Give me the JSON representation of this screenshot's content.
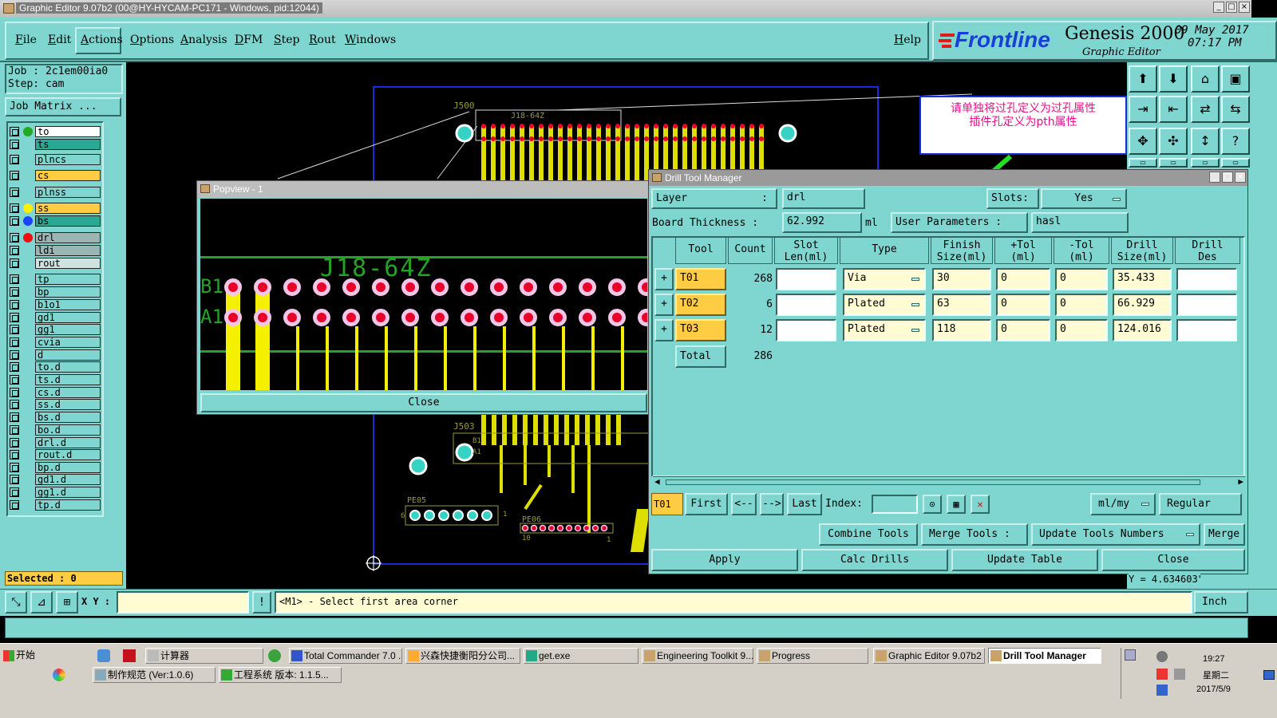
{
  "app": {
    "window_title": "Graphic Editor 9.07b2 (00@HY-HYCAM-PC171 - Windows, pid:12044)",
    "menus": [
      "File",
      "Edit",
      "Actions",
      "Options",
      "Analysis",
      "DFM",
      "Step",
      "Rout",
      "Windows"
    ],
    "help": "Help",
    "brand_logo": "Frontline",
    "product": "Genesis 2000",
    "product_sub": "Graphic Editor",
    "date": "09 May 2017",
    "time": "07:17 PM"
  },
  "left_panel": {
    "job_label": "Job : 2c1em00ia0",
    "step_label": "Step: cam",
    "job_matrix": "Job Matrix ...",
    "layers": [
      {
        "name": "to",
        "color": "#22aa22",
        "dot": "#22aa22",
        "bg": "#ffffff"
      },
      {
        "name": "ts",
        "color": "#2e8b7e",
        "dot": "",
        "bg": "#2aa896"
      },
      {
        "name": "plncs",
        "color": "",
        "dot": "",
        "bg": "#7fd5cf"
      },
      {
        "name": "cs",
        "color": "",
        "dot": "",
        "bg": "#ffcc44"
      },
      {
        "name": "plnss",
        "color": "",
        "dot": "",
        "bg": "#7fd5cf"
      },
      {
        "name": "ss",
        "color": "",
        "dot": "#ffee00",
        "bg": "#ffcc44"
      },
      {
        "name": "bs",
        "color": "",
        "dot": "#1a44ff",
        "bg": "#2aa896"
      },
      {
        "name": "drl",
        "color": "",
        "dot": "#ee1111",
        "bg": "#9bb5b3"
      },
      {
        "name": "ldi",
        "color": "",
        "dot": "",
        "bg": "#9bb5b3"
      },
      {
        "name": "rout",
        "color": "",
        "dot": "",
        "bg": "#cfe2e0"
      },
      {
        "name": "tp",
        "color": "",
        "dot": "",
        "bg": "#7fd5cf"
      },
      {
        "name": "bp",
        "color": "",
        "dot": "",
        "bg": "#7fd5cf"
      },
      {
        "name": "b1o1",
        "color": "",
        "dot": "",
        "bg": "#7fd5cf"
      },
      {
        "name": "gd1",
        "color": "",
        "dot": "",
        "bg": "#7fd5cf"
      },
      {
        "name": "gg1",
        "color": "",
        "dot": "",
        "bg": "#7fd5cf"
      },
      {
        "name": "cvia",
        "color": "",
        "dot": "",
        "bg": "#7fd5cf"
      },
      {
        "name": "d",
        "color": "",
        "dot": "",
        "bg": "#7fd5cf"
      },
      {
        "name": "to.d",
        "color": "",
        "dot": "",
        "bg": "#7fd5cf"
      },
      {
        "name": "ts.d",
        "color": "",
        "dot": "",
        "bg": "#7fd5cf"
      },
      {
        "name": "cs.d",
        "color": "",
        "dot": "",
        "bg": "#7fd5cf"
      },
      {
        "name": "ss.d",
        "color": "",
        "dot": "",
        "bg": "#7fd5cf"
      },
      {
        "name": "bs.d",
        "color": "",
        "dot": "",
        "bg": "#7fd5cf"
      },
      {
        "name": "bo.d",
        "color": "",
        "dot": "",
        "bg": "#7fd5cf"
      },
      {
        "name": "drl.d",
        "color": "",
        "dot": "",
        "bg": "#7fd5cf"
      },
      {
        "name": "rout.d",
        "color": "",
        "dot": "",
        "bg": "#7fd5cf"
      },
      {
        "name": "bp.d",
        "color": "",
        "dot": "",
        "bg": "#7fd5cf"
      },
      {
        "name": "gd1.d",
        "color": "",
        "dot": "",
        "bg": "#7fd5cf"
      },
      {
        "name": "gg1.d",
        "color": "",
        "dot": "",
        "bg": "#7fd5cf"
      },
      {
        "name": "tp.d",
        "color": "",
        "dot": "",
        "bg": "#7fd5cf"
      }
    ],
    "selected": "Selected : 0"
  },
  "canvas": {
    "labels": [
      "J500",
      "J18-64Z",
      "J503",
      "B1",
      "A1",
      "PE05",
      "PE06",
      "6",
      "1",
      "10",
      "1"
    ]
  },
  "annotation": {
    "line1": "请单独将过孔定义为过孔属性",
    "line2": "插件孔定义为pth属性"
  },
  "popview": {
    "title": "Popview - 1",
    "label": "J18-64Z",
    "row_b": "B1",
    "row_a": "A1",
    "close": "Close"
  },
  "drill": {
    "title": "Drill Tool Manager",
    "layer_label": "Layer",
    "layer_colon": ":",
    "layer_value": "drl",
    "slots_label": "Slots:",
    "slots_value": "Yes",
    "board_thickness_label": "Board Thickness :",
    "board_thickness_value": "62.992",
    "board_thickness_unit": "ml",
    "user_params_label": "User Parameters :",
    "user_params_value": "hasl",
    "headers": [
      "Tool",
      "Count",
      "Slot\nLen(ml)",
      "Type",
      "Finish\nSize(ml)",
      "+Tol\n(ml)",
      "-Tol\n(ml)",
      "Drill\nSize(ml)",
      "Drill\nDes"
    ],
    "rows": [
      {
        "tool": "T01",
        "count": "268",
        "slot": "",
        "type": "Via",
        "finish": "30",
        "ptol": "0",
        "mtol": "0",
        "drill": "35.433",
        "des": ""
      },
      {
        "tool": "T02",
        "count": "6",
        "slot": "",
        "type": "Plated",
        "finish": "63",
        "ptol": "0",
        "mtol": "0",
        "drill": "66.929",
        "des": ""
      },
      {
        "tool": "T03",
        "count": "12",
        "slot": "",
        "type": "Plated",
        "finish": "118",
        "ptol": "0",
        "mtol": "0",
        "drill": "124.016",
        "des": ""
      }
    ],
    "total_label": "Total",
    "total_value": "286",
    "nav": {
      "current": "T01",
      "first": "First",
      "prev": "<--",
      "next": "-->",
      "last": "Last",
      "index": "Index:",
      "units": "ml/my",
      "mode": "Regular"
    },
    "actions": {
      "combine": "Combine Tools",
      "merge_tools": "Merge Tools :",
      "update_numbers": "Update Tools Numbers",
      "merge": "Merge"
    },
    "bottom": {
      "apply": "Apply",
      "calc": "Calc Drills",
      "update": "Update Table",
      "close": "Close"
    },
    "coord_y": "Y = 4.634603\""
  },
  "statusbar": {
    "xy_label": "X Y :",
    "message": "<M1> - Select first area corner",
    "units": "Inch"
  },
  "taskbar": {
    "start": "开始",
    "row1": [
      "计算器",
      "Total Commander 7.0 ...",
      "兴森快捷衡阳分公司...",
      "get.exe",
      "Engineering Toolkit 9....",
      "Progress",
      "Graphic Editor 9.07b2 ...",
      "Drill Tool Manager"
    ],
    "row2": [
      "制作规范 (Ver:1.0.6)",
      "工程系统  版本: 1.1.5..."
    ],
    "clock_time": "19:27",
    "clock_day": "星期二",
    "clock_date": "2017/5/9"
  }
}
